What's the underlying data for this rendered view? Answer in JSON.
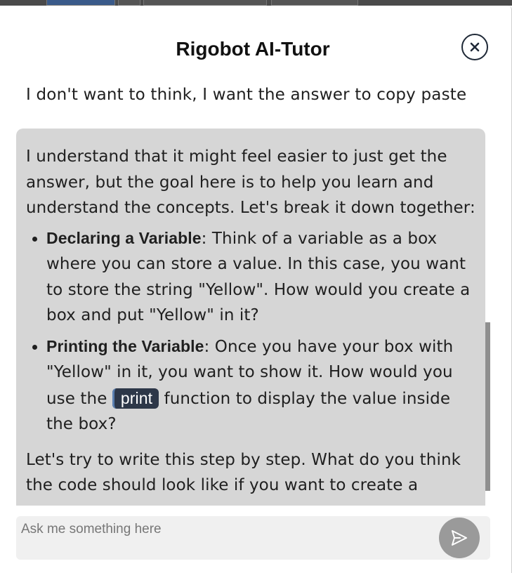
{
  "modal": {
    "title": "Rigobot AI-Tutor",
    "close_icon": "close-icon"
  },
  "conversation": {
    "user_message": "I don't want to think, I want the answer to copy paste",
    "bot_reply": {
      "intro": "I understand that it might feel easier to just get the answer, but the goal here is to help you learn and understand the concepts. Let's break it down together:",
      "bullets": [
        {
          "title": "Declaring a Variable",
          "text": ": Think of a variable as a box where you can store a value. In this case, you want to store the string \"Yellow\". How would you create a box and put \"Yellow\" in it?"
        },
        {
          "title": "Printing the Variable",
          "text_before": ": Once you have your box with \"Yellow\" in it, you want to show it. How would you use the ",
          "code": "print",
          "text_after": " function to display the value inside the box?"
        }
      ],
      "outro": "Let's try to write this step by step. What do you think the code should look like if you want to create a"
    }
  },
  "composer": {
    "placeholder": "Ask me something here",
    "value": "",
    "send_icon": "send-icon"
  },
  "colors": {
    "bot_bubble": "#d6d6d6",
    "code_bg": "#2d3748",
    "send_button": "#9a9a9a",
    "input_bg": "#f0f0f0"
  }
}
